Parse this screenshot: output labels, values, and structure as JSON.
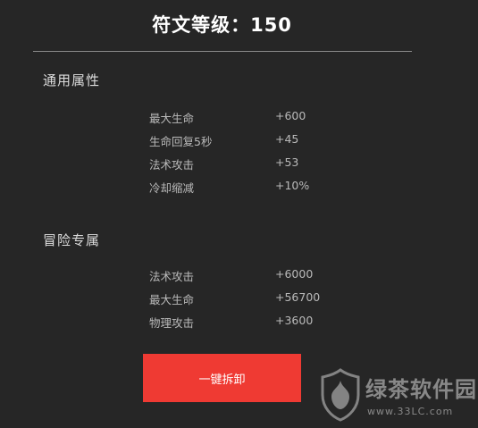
{
  "header": {
    "title": "符文等级：150"
  },
  "sections": [
    {
      "title": "通用属性",
      "stats": [
        {
          "name": "最大生命",
          "value": "+600"
        },
        {
          "name": "生命回复5秒",
          "value": "+45"
        },
        {
          "name": "法术攻击",
          "value": "+53"
        },
        {
          "name": "冷却缩减",
          "value": "+10%"
        }
      ]
    },
    {
      "title": "冒险专属",
      "stats": [
        {
          "name": "法术攻击",
          "value": "+6000"
        },
        {
          "name": "最大生命",
          "value": "+56700"
        },
        {
          "name": "物理攻击",
          "value": "+3600"
        }
      ]
    }
  ],
  "actions": {
    "dismantle_label": "一键拆卸"
  },
  "watermark": {
    "brand": "绿茶软件园",
    "url": "www.33LC.com"
  },
  "colors": {
    "background": "#262626",
    "button": "#ef3a33",
    "text_primary": "#ffffff",
    "text_secondary": "#b9b9b9"
  }
}
